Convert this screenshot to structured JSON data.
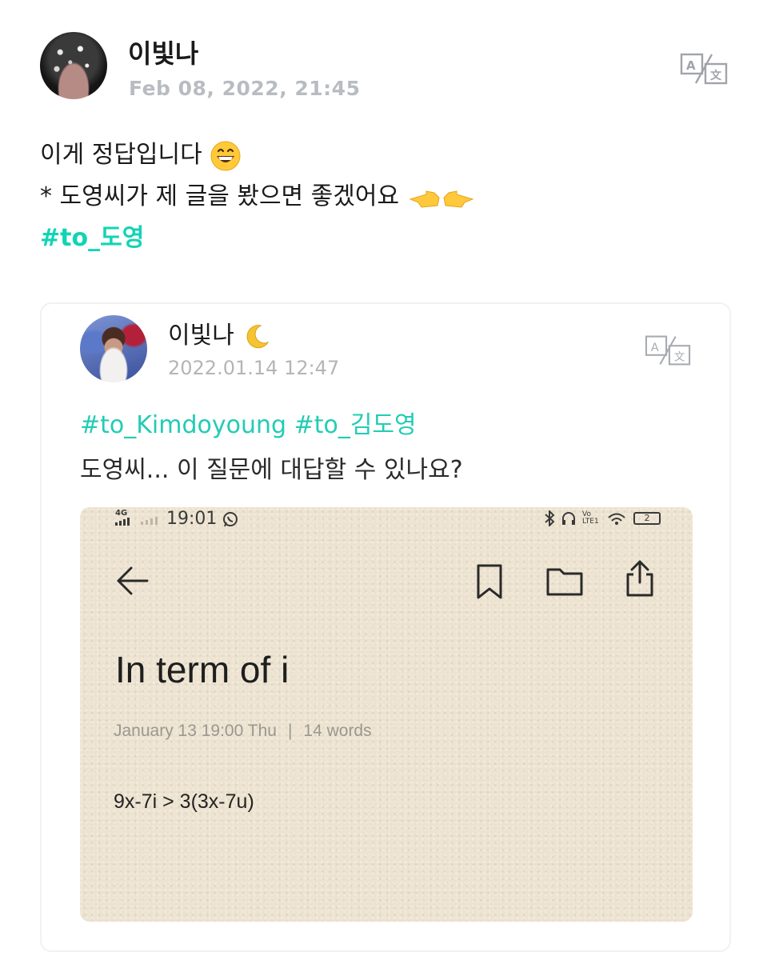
{
  "post": {
    "author": "이빛나",
    "date": "Feb 08, 2022, 21:45",
    "line1": "이게 정답입니다",
    "line2": "* 도영씨가 제 글을 봤으면 좋겠어요",
    "hashtag": "#to_도영",
    "icons": [
      "avatar",
      "translate-icon",
      "grinning-emoji",
      "pointing-hands-emoji"
    ],
    "accent_color": "#11d4b5"
  },
  "card": {
    "author": "이빛나",
    "date": "2022.01.14 12:47",
    "hashtags": "#to_Kimdoyoung #to_김도영",
    "text": "도영씨... 이 질문에 대답할 수 있나요?",
    "icons": [
      "avatar",
      "crescent-moon-emoji",
      "translate-icon"
    ]
  },
  "screenshot": {
    "status_network": "4G",
    "status_time": "19:01",
    "status_volte": "Vo LTE1",
    "battery": "2",
    "note_title": "In term of i",
    "note_date": "January 13 19:00 Thu",
    "note_meta_sep": "|",
    "note_words": "14 words",
    "note_body": "9x-7i > 3(3x-7u)",
    "icons": [
      "back-arrow-icon",
      "bookmark-icon",
      "folder-icon",
      "share-icon",
      "whatsapp-icon",
      "bluetooth-icon",
      "headphones-icon",
      "wifi-icon",
      "battery-icon"
    ]
  }
}
